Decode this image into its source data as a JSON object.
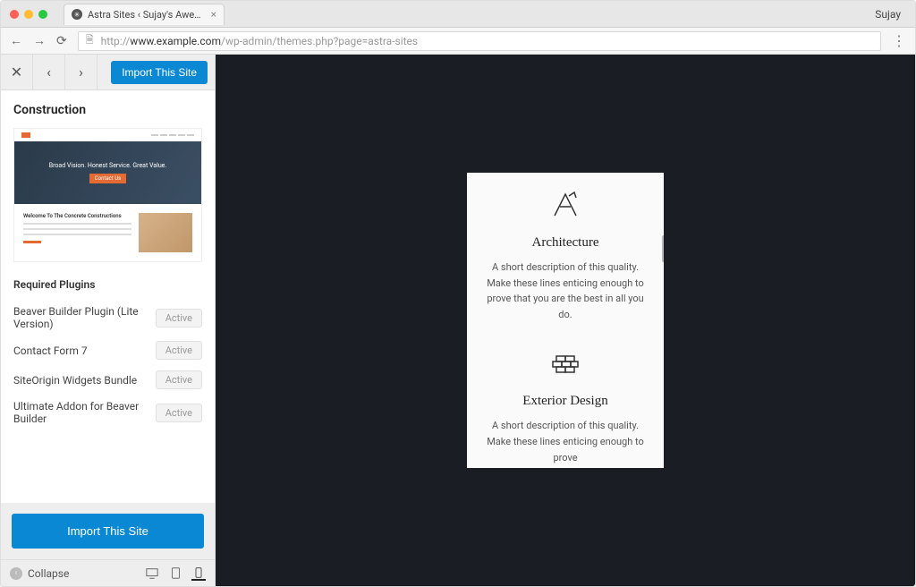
{
  "browser": {
    "traffic": [
      "#ff5f57",
      "#febc2e",
      "#28c840"
    ],
    "tab_title": "Astra Sites ‹ Sujay's Awesome",
    "profile": "Sujay",
    "url_dark": "www.example.com",
    "url_light": "/wp-admin/themes.php?page=astra-sites",
    "url_prefix": "http://"
  },
  "sidebar": {
    "import_btn": "Import This Site",
    "site_title": "Construction",
    "hero_text": "Broad Vision. Honest Service. Great Value.",
    "hero_cta": "Contact Us",
    "thumb_heading": "Welcome To The Concrete Constructions",
    "plugins_heading": "Required Plugins",
    "plugins": [
      {
        "name": "Beaver Builder Plugin (Lite Version)",
        "status": "Active"
      },
      {
        "name": "Contact Form 7",
        "status": "Active"
      },
      {
        "name": "SiteOrigin Widgets Bundle",
        "status": "Active"
      },
      {
        "name": "Ultimate Addon for Beaver Builder",
        "status": "Active"
      }
    ],
    "import_large": "Import This Site",
    "collapse": "Collapse"
  },
  "preview": {
    "features": [
      {
        "title": "Architecture",
        "desc": "A short description of this quality. Make these lines enticing enough to prove that you are the best in all you do."
      },
      {
        "title": "Exterior Design",
        "desc": "A short description of this quality. Make these lines enticing enough to prove"
      }
    ]
  }
}
